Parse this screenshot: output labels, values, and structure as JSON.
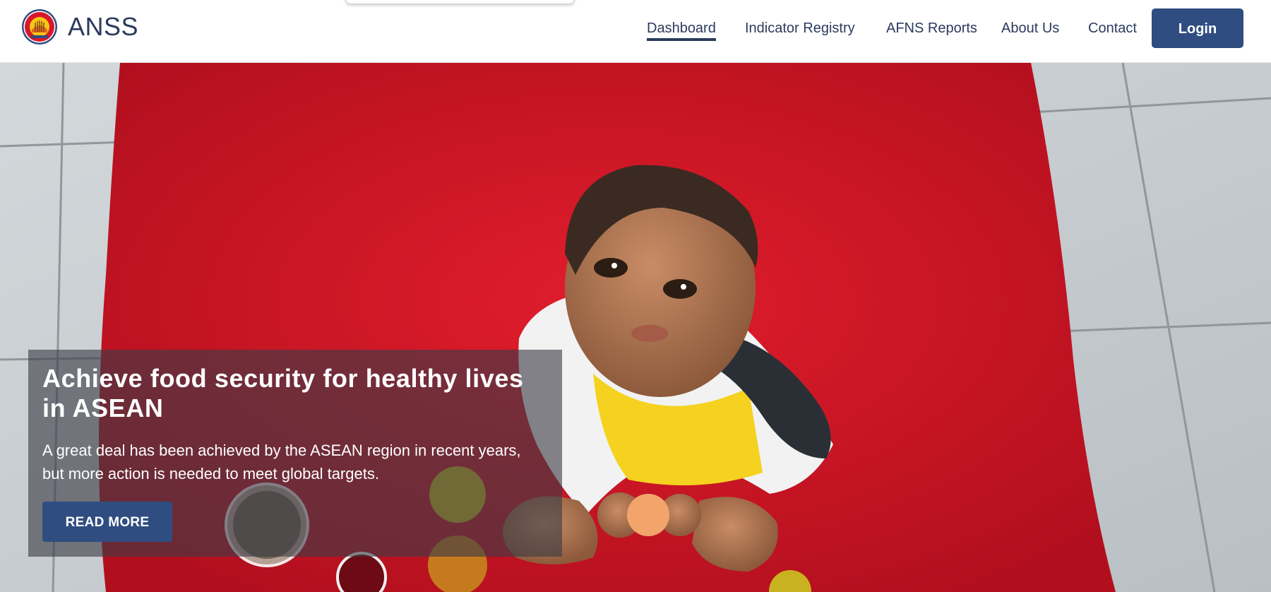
{
  "header": {
    "brand": "ANSS",
    "logo_icon": "asean-emblem-icon",
    "nav": [
      {
        "label": "Dashboard",
        "active": true
      },
      {
        "label": "Indicator Registry",
        "active": false
      },
      {
        "label": "AFNS Reports",
        "active": false
      },
      {
        "label": "About Us",
        "active": false
      },
      {
        "label": "Contact",
        "active": false
      }
    ],
    "login_label": "Login"
  },
  "hero": {
    "title": "Achieve food security for healthy lives in ASEAN",
    "text": "A great deal has been achieved by the ASEAN region in recent years, but more action is needed to meet global targets.",
    "button_label": "READ MORE"
  },
  "colors": {
    "brand_navy": "#2b3b5e",
    "button_blue": "#2f4d80",
    "rug_red": "#d7182a",
    "tile_grey": "#c7cdd1"
  }
}
